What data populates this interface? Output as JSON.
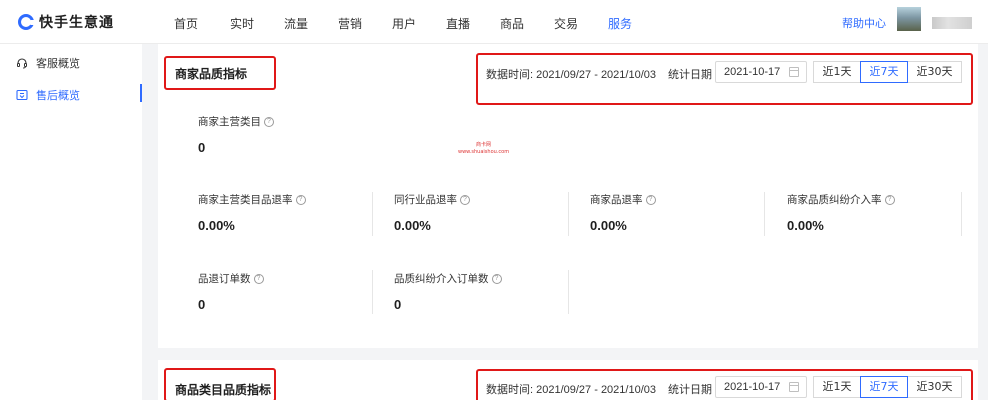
{
  "brand": {
    "name": "快手生意通",
    "logo_icon": "kuaishou-logo-icon"
  },
  "nav": {
    "items": [
      "首页",
      "实时",
      "流量",
      "营销",
      "用户",
      "直播",
      "商品",
      "交易",
      "服务"
    ],
    "active_index": 8,
    "help": "帮助中心"
  },
  "sidebar": {
    "items": [
      {
        "label": "客服概览",
        "icon": "headset-icon"
      },
      {
        "label": "售后概览",
        "icon": "aftersale-icon"
      }
    ],
    "active_index": 1
  },
  "colors": {
    "accent": "#2f6bff",
    "annotation_red": "#e01818"
  },
  "watermark": {
    "line1": "商卡网",
    "line2": "www.shuaishou.com"
  },
  "card1": {
    "title": "商家品质指标",
    "data_time_label": "数据时间: 2021/09/27 - 2021/10/03",
    "stat_date_label": "统计日期",
    "date_value": "2021-10-17",
    "ranges": [
      "近1天",
      "近7天",
      "近30天"
    ],
    "active_range": 1,
    "metrics": {
      "main_category": {
        "label": "商家主营类目",
        "value": "0"
      },
      "row1": [
        {
          "label": "商家主营类目品退率",
          "value": "0.00%"
        },
        {
          "label": "同行业品退率",
          "value": "0.00%"
        },
        {
          "label": "商家品退率",
          "value": "0.00%"
        },
        {
          "label": "商家品质纠纷介入率",
          "value": "0.00%"
        }
      ],
      "row2": [
        {
          "label": "品退订单数",
          "value": "0"
        },
        {
          "label": "品质纠纷介入订单数",
          "value": "0"
        }
      ]
    }
  },
  "card2": {
    "title": "商品类目品质指标",
    "data_time_label": "数据时间: 2021/09/27 - 2021/10/03",
    "stat_date_label": "统计日期",
    "date_value": "2021-10-17",
    "ranges": [
      "近1天",
      "近7天",
      "近30天"
    ],
    "active_range": 1
  }
}
